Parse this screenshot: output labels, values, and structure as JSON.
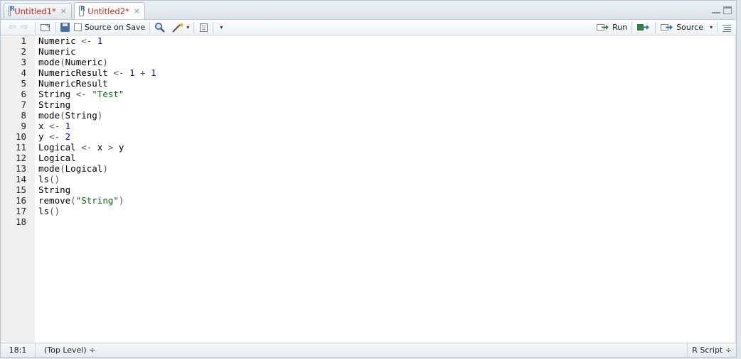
{
  "tabs": [
    {
      "label": "Untitled1*",
      "close": "×",
      "active": false
    },
    {
      "label": "Untitled2*",
      "close": "×",
      "active": true
    }
  ],
  "toolbar": {
    "source_on_save_label": "Source on Save",
    "run_label": "Run",
    "source_label": "Source",
    "dropdown_glyph": "▾"
  },
  "editor": {
    "lines": [
      {
        "n": "1",
        "tokens": [
          {
            "t": "Numeric ",
            "c": "plain"
          },
          {
            "t": "<-",
            "c": "op"
          },
          {
            "t": " 1",
            "c": "num"
          }
        ]
      },
      {
        "n": "2",
        "tokens": [
          {
            "t": "Numeric",
            "c": "plain"
          }
        ]
      },
      {
        "n": "3",
        "tokens": [
          {
            "t": "mode",
            "c": "plain"
          },
          {
            "t": "(",
            "c": "op"
          },
          {
            "t": "Numeric",
            "c": "plain"
          },
          {
            "t": ")",
            "c": "op"
          }
        ]
      },
      {
        "n": "4",
        "tokens": [
          {
            "t": "NumericResult ",
            "c": "plain"
          },
          {
            "t": "<-",
            "c": "op"
          },
          {
            "t": " 1",
            "c": "num"
          },
          {
            "t": " + ",
            "c": "op"
          },
          {
            "t": "1",
            "c": "num"
          }
        ]
      },
      {
        "n": "5",
        "tokens": [
          {
            "t": "NumericResult",
            "c": "plain"
          }
        ]
      },
      {
        "n": "6",
        "tokens": [
          {
            "t": "String ",
            "c": "plain"
          },
          {
            "t": "<-",
            "c": "op"
          },
          {
            "t": " \"Test\"",
            "c": "str"
          }
        ]
      },
      {
        "n": "7",
        "tokens": [
          {
            "t": "String",
            "c": "plain"
          }
        ]
      },
      {
        "n": "8",
        "tokens": [
          {
            "t": "mode",
            "c": "plain"
          },
          {
            "t": "(",
            "c": "op"
          },
          {
            "t": "String",
            "c": "plain"
          },
          {
            "t": ")",
            "c": "op"
          }
        ]
      },
      {
        "n": "9",
        "tokens": [
          {
            "t": "x ",
            "c": "plain"
          },
          {
            "t": "<-",
            "c": "op"
          },
          {
            "t": " 1",
            "c": "num"
          }
        ]
      },
      {
        "n": "10",
        "tokens": [
          {
            "t": "y ",
            "c": "plain"
          },
          {
            "t": "<-",
            "c": "op"
          },
          {
            "t": " 2",
            "c": "num"
          }
        ]
      },
      {
        "n": "11",
        "tokens": [
          {
            "t": "Logical ",
            "c": "plain"
          },
          {
            "t": "<-",
            "c": "op"
          },
          {
            "t": " x ",
            "c": "plain"
          },
          {
            "t": ">",
            "c": "op"
          },
          {
            "t": " y",
            "c": "plain"
          }
        ]
      },
      {
        "n": "12",
        "tokens": [
          {
            "t": "Logical",
            "c": "plain"
          }
        ]
      },
      {
        "n": "13",
        "tokens": [
          {
            "t": "mode",
            "c": "plain"
          },
          {
            "t": "(",
            "c": "op"
          },
          {
            "t": "Logical",
            "c": "plain"
          },
          {
            "t": ")",
            "c": "op"
          }
        ]
      },
      {
        "n": "14",
        "tokens": [
          {
            "t": "ls",
            "c": "plain"
          },
          {
            "t": "()",
            "c": "op"
          }
        ]
      },
      {
        "n": "15",
        "tokens": [
          {
            "t": "String",
            "c": "plain"
          }
        ]
      },
      {
        "n": "16",
        "tokens": [
          {
            "t": "remove",
            "c": "plain"
          },
          {
            "t": "(",
            "c": "op"
          },
          {
            "t": "\"String\"",
            "c": "str"
          },
          {
            "t": ")",
            "c": "op"
          }
        ]
      },
      {
        "n": "17",
        "tokens": [
          {
            "t": "ls",
            "c": "plain"
          },
          {
            "t": "()",
            "c": "op"
          }
        ]
      },
      {
        "n": "18",
        "tokens": []
      }
    ]
  },
  "status": {
    "cursor": "18:1",
    "scope": "(Top Level) ÷",
    "filetype": "R Script ÷"
  },
  "colors": {
    "plain": "#000000",
    "op": "#555555",
    "num": "#0000cd",
    "str": "#036a07",
    "tab_label": "#c0271d"
  }
}
